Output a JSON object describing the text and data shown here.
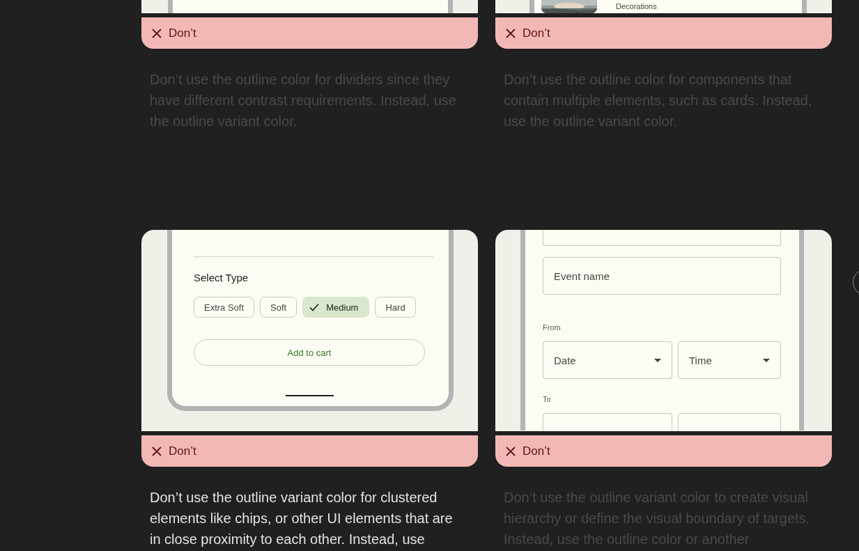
{
  "rows": [
    {
      "mockups": [
        {
          "kind": "blank"
        },
        {
          "kind": "list_item",
          "title": "Decorations"
        }
      ],
      "verdicts": [
        {
          "kind": "dont",
          "label": "Don’t"
        },
        {
          "kind": "dont",
          "label": "Don’t"
        }
      ],
      "captions": [
        {
          "text": "Don’t use the outline color for dividers since they have different contrast requirements. Instead, use the outline variant color.",
          "highlighted": false
        },
        {
          "text": "Don’t use the outline color for components that contain multiple elements, such as cards. Instead, use the outline variant color.",
          "highlighted": false
        }
      ]
    },
    {
      "mockups": [
        {
          "kind": "chips",
          "heading": "Select Type",
          "chips": [
            {
              "label": "Extra Soft",
              "selected": false
            },
            {
              "label": "Soft",
              "selected": false
            },
            {
              "label": "Medium",
              "selected": true
            },
            {
              "label": "Hard",
              "selected": false
            }
          ],
          "button": "Add to cart"
        },
        {
          "kind": "form",
          "event_field": "Event name",
          "groups": [
            {
              "label": "From",
              "date": "Date",
              "time": "Time"
            },
            {
              "label": "To"
            }
          ]
        }
      ],
      "verdicts": [
        {
          "kind": "dont",
          "label": "Don’t"
        },
        {
          "kind": "dont",
          "label": "Don’t"
        }
      ],
      "captions": [
        {
          "text": "Don’t use the outline variant color for clustered elements like chips, or other UI elements that are in close proximity to each other. Instead, use",
          "highlighted": true
        },
        {
          "text": "Don’t use the outline variant color to create visual hierarchy or define the visual boundary of targets. Instead, use the outline color or another",
          "highlighted": false
        }
      ]
    }
  ]
}
